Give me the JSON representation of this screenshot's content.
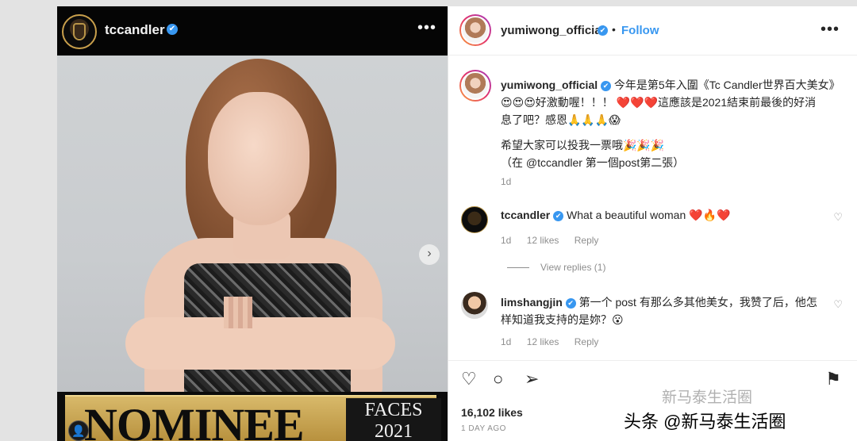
{
  "left_post": {
    "username": "tccandler",
    "more_label": "•••",
    "next_label": "›",
    "nominee_label": "NOMINEE",
    "faces_label": "FACES",
    "faces_year": "2021"
  },
  "header": {
    "username": "yumiwong_official",
    "dot": "•",
    "follow_label": "Follow",
    "more_label": "•••"
  },
  "caption": {
    "username": "yumiwong_official",
    "line1": "今年是第5年入圍《Tc Candler世界百大美女》",
    "line2": "😍😍😍好激動喔！！！ ❤️❤️❤️這應該是2021結束前最後的好消",
    "line3": "息了吧？感恩🙏🙏🙏😱",
    "line4": "希望大家可以投我一票哦🎉🎉🎉",
    "line5": "（在 @tccandler 第一個post第二張）",
    "time": "1d"
  },
  "comments": [
    {
      "username": "tccandler",
      "text": "What a beautiful woman ❤️🔥❤️",
      "time": "1d",
      "likes": "12 likes",
      "reply": "Reply"
    },
    {
      "username": "limshangjin",
      "text": "第一个 post 有那么多其他美女，我赞了后，他怎样知道我支持的是妳？😮",
      "time": "1d",
      "likes": "12 likes",
      "reply": "Reply"
    }
  ],
  "view_replies": "View replies (1)",
  "actions": {
    "likes": "16,102 likes",
    "posted": "1 DAY AGO"
  },
  "watermark": {
    "line1": "新马泰生活圈",
    "line2": "头条 @新马泰生活圈"
  },
  "icons": {
    "verified": "✔",
    "like": "♡",
    "comment": "○",
    "share": "➢",
    "save": "⚑",
    "heart_small": "♡",
    "tag": "👤"
  },
  "colors": {
    "accent": "#3897f0",
    "gold": "#c9a04c"
  }
}
